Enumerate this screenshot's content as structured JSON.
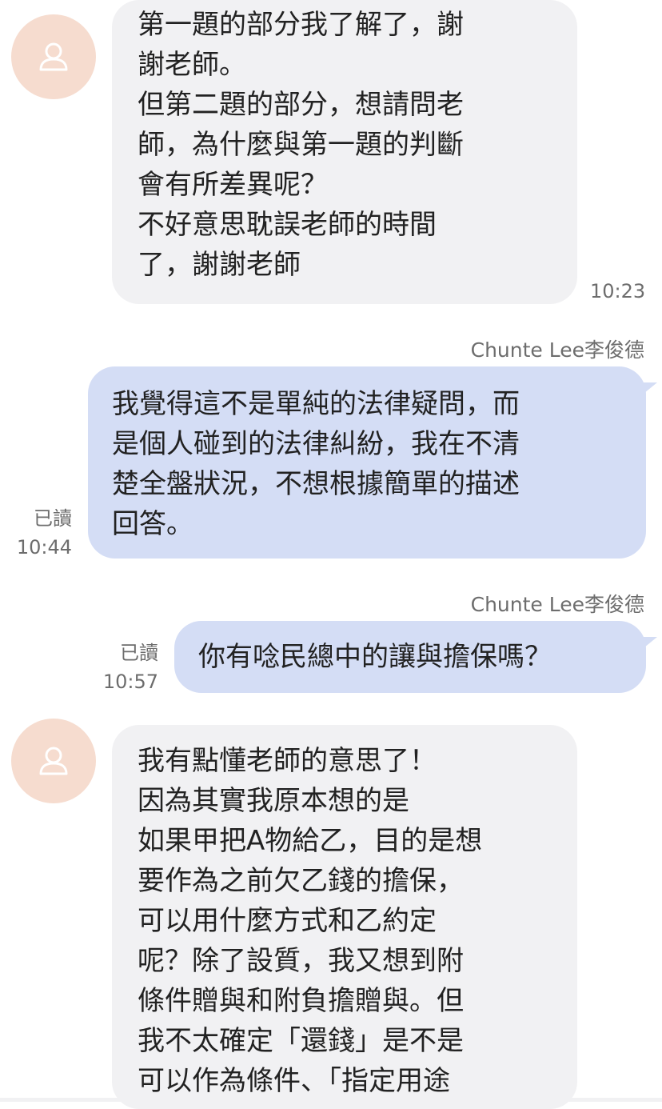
{
  "messages": [
    {
      "direction": "incoming",
      "text": "第一題的部分我了解了，謝\n謝老師。\n但第二題的部分，想請問老\n師，為什麼與第一題的判斷\n會有所差異呢？\n不好意思耽誤老師的時間\n了，謝謝老師",
      "time": "10:23"
    },
    {
      "direction": "outgoing",
      "sender": "Chunte  Lee李俊德",
      "text": "我覺得這不是單純的法律疑問，而\n是個人碰到的法律糾紛，我在不清\n楚全盤狀況，不想根據簡單的描述\n回答。",
      "read_label": "已讀",
      "time": "10:44"
    },
    {
      "direction": "outgoing",
      "sender": "Chunte  Lee李俊德",
      "text": "你有唸民總中的讓與擔保嗎？",
      "read_label": "已讀",
      "time": "10:57"
    },
    {
      "direction": "incoming",
      "text": "我有點懂老師的意思了！\n因為其實我原本想的是\n如果甲把A物給乙，目的是想\n要作為之前欠乙錢的擔保，\n可以用什麼方式和乙約定\n呢？除了設質，我又想到附\n條件贈與和附負擔贈與。但\n我不太確定「還錢」是不是\n可以作為條件、「指定用途"
    }
  ],
  "icons": {
    "avatar": "person-outline-icon"
  },
  "colors": {
    "incoming_bubble": "#f1f1f3",
    "outgoing_bubble": "#d4ddf5",
    "avatar_bg": "#f6dccf",
    "meta_text": "#6d6d6d"
  }
}
